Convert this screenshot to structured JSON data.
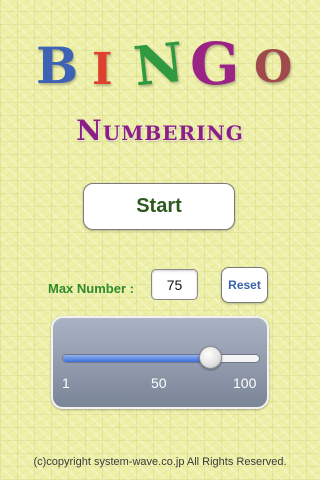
{
  "app": {
    "title_letters": [
      "B",
      "I",
      "N",
      "G",
      "O"
    ],
    "subtitle": "Numbering"
  },
  "start": {
    "label": "Start"
  },
  "max_number": {
    "label": "Max Number :",
    "value": "75",
    "reset_label": "Reset"
  },
  "slider": {
    "min": 1,
    "max": 100,
    "value": 75,
    "tick_labels": [
      "1",
      "50",
      "100"
    ]
  },
  "footer": {
    "copyright": "(c)copyright system-wave.co.jp All Rights Reserved."
  },
  "colors": {
    "b": "#3e63b5",
    "i": "#e0412e",
    "n": "#2f9a3f",
    "g": "#9a2486",
    "o": "#a04a4e",
    "subtitle": "#8c1f87",
    "label_green": "#2f8a2b",
    "reset_blue": "#3b63a8",
    "slider_fill": "#3d6fd8"
  }
}
